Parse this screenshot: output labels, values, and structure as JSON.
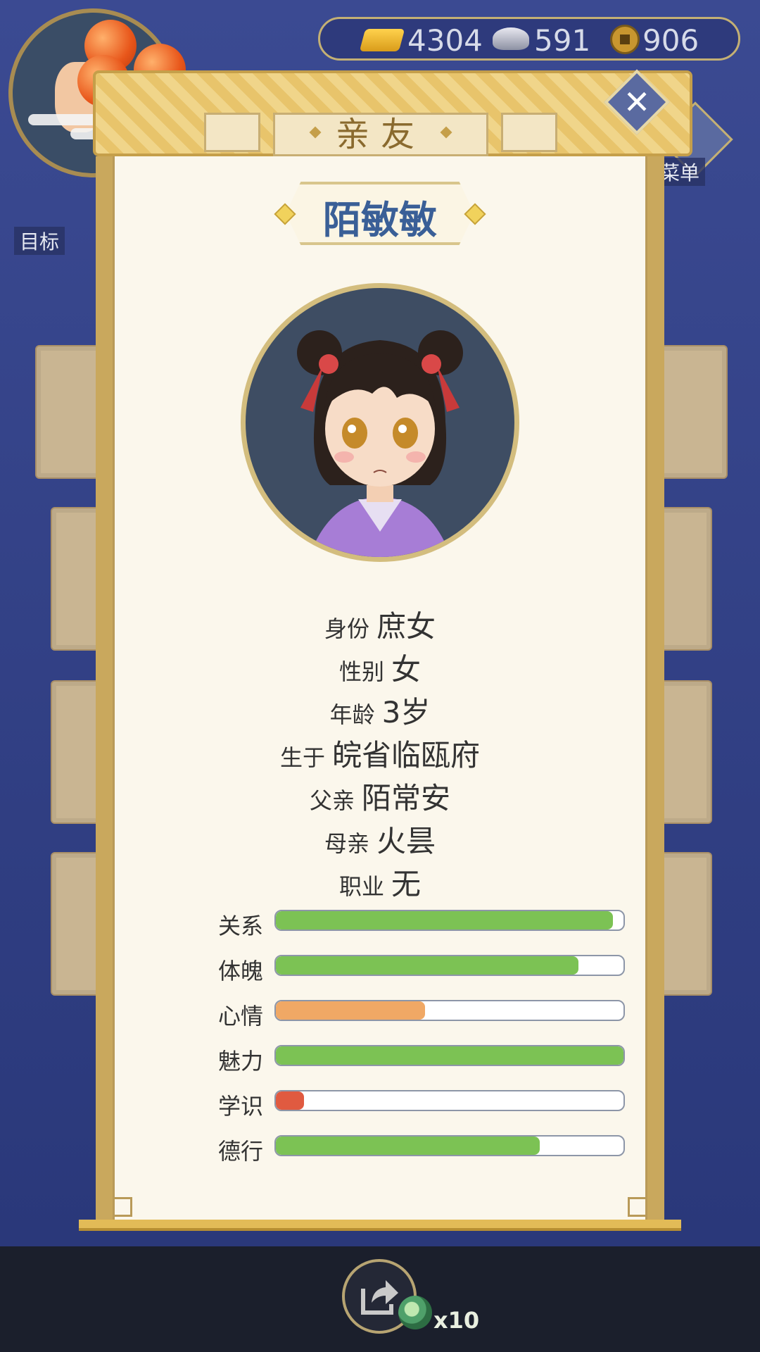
{
  "currency": {
    "gold": "4304",
    "silver": "591",
    "coins": "906"
  },
  "side": {
    "goal_label": "目标",
    "menu_label": "菜单"
  },
  "dialog": {
    "title": "亲友",
    "close_icon": "close-icon"
  },
  "person": {
    "name": "陌敏敏",
    "info": [
      {
        "key": "身份",
        "value": "庶女"
      },
      {
        "key": "性别",
        "value": "女"
      },
      {
        "key": "年龄",
        "value": "3岁"
      },
      {
        "key": "生于",
        "value": "皖省临瓯府"
      },
      {
        "key": "父亲",
        "value": "陌常安"
      },
      {
        "key": "母亲",
        "value": "火昙"
      },
      {
        "key": "职业",
        "value": "无"
      }
    ],
    "stats": [
      {
        "label": "关系",
        "fraction": 0.97,
        "color": "#7cc254"
      },
      {
        "label": "体魄",
        "fraction": 0.87,
        "color": "#7cc254"
      },
      {
        "label": "心情",
        "fraction": 0.43,
        "color": "#f0a865"
      },
      {
        "label": "魅力",
        "fraction": 1.0,
        "color": "#7cc254"
      },
      {
        "label": "学识",
        "fraction": 0.08,
        "color": "#e05a40"
      },
      {
        "label": "德行",
        "fraction": 0.76,
        "color": "#7cc254"
      }
    ]
  },
  "footer": {
    "share_icon": "share-icon",
    "item_count": "x10"
  }
}
